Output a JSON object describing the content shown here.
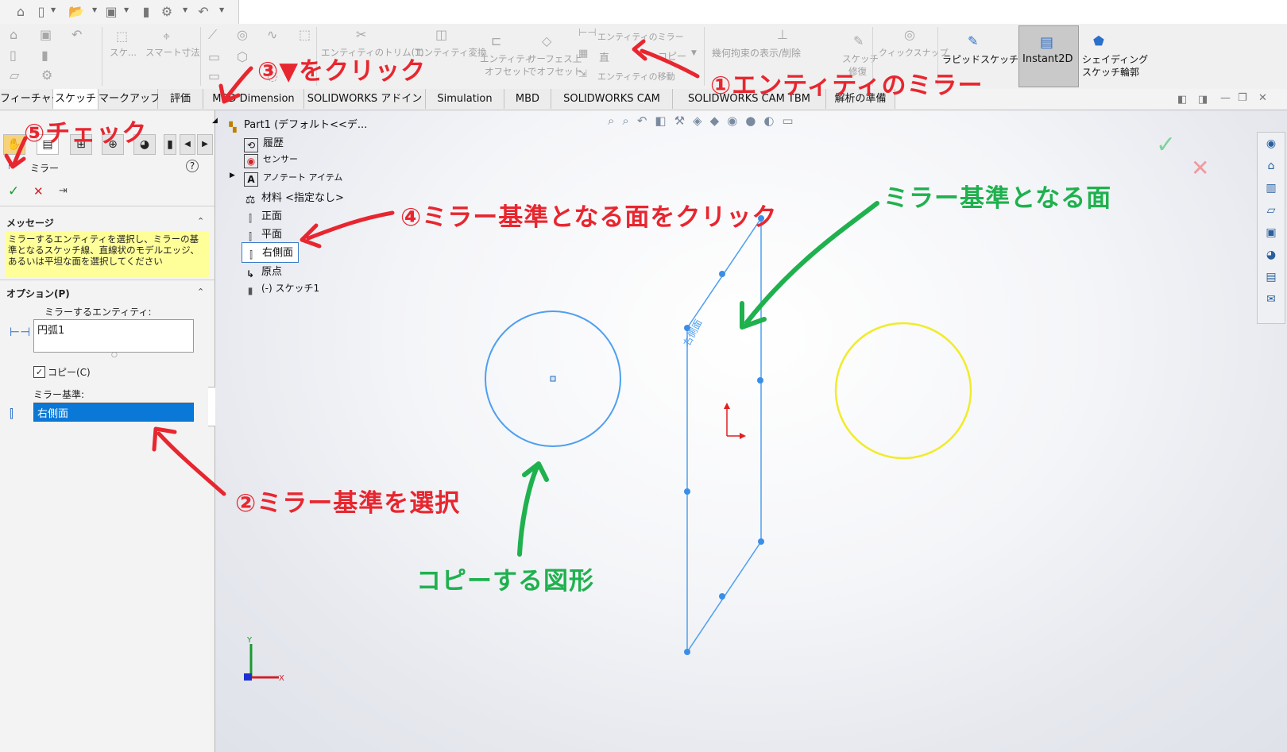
{
  "quickbar": {
    "icons": [
      "home-icon",
      "new-file-icon",
      "open-icon",
      "save-icon",
      "print-icon",
      "gear-icon",
      "undo-icon"
    ]
  },
  "ribbon": {
    "sketch": "スケ...",
    "smart_dim": "スマート寸法",
    "trim": "エンティティのトリム(T)",
    "convert": "エンティティ変換",
    "offset_1": "エンティティ",
    "offset_2": "オフセット",
    "surface_1": "サーフェス上",
    "surface_2": "でオフセット",
    "mirror": "エンティティのミラー",
    "linear_pattern": "直",
    "copy": "コピー",
    "move": "エンティティの移動",
    "relations": "幾何拘束の表示/削除",
    "repair_1": "スケッチ",
    "repair_2": "修復",
    "quick_snap": "クィックスナップ",
    "rapid_sketch": "ラピッドスケッチ",
    "instant2d": "Instant2D",
    "shaded_1": "シェイディング",
    "shaded_2": "スケッチ輪郭"
  },
  "tabs": [
    "フィーチャー",
    "スケッチ",
    "マークアップ",
    "評価",
    "MBD Dimension",
    "SOLIDWORKS アドイン",
    "Simulation",
    "MBD",
    "SOLIDWORKS CAM",
    "SOLIDWORKS CAM TBM",
    "解析の準備"
  ],
  "panel": {
    "title": "ミラー",
    "help": "?",
    "message_header": "メッセージ",
    "message": "ミラーするエンティティを選択し、ミラーの基準となるスケッチ線、直線状のモデルエッジ、あるいは平坦な面を選択してください",
    "options_header": "オプション(P)",
    "entities_label": "ミラーするエンティティ:",
    "entities_value": "円弧1",
    "copy_label": "コピー(C)",
    "mirror_about_label": "ミラー基準:",
    "mirror_about_value": "右側面"
  },
  "tree": {
    "root": "Part1 (デフォルト<<デ...",
    "items": [
      "履歴",
      "センサー",
      "アノテート アイテム",
      "材料 <指定なし>",
      "正面",
      "平面",
      "右側面",
      "原点",
      "(-) スケッチ1"
    ]
  },
  "viewport": {
    "plane_label": "右側面",
    "axis_x": "X",
    "axis_y": "Y"
  },
  "annotations": {
    "step1": "①エンティティのミラー",
    "step2": "②ミラー基準を選択",
    "step3": "③▼をクリック",
    "step4": "④ミラー基準となる面をクリック",
    "step5": "⑤チェック",
    "green_plane": "ミラー基準となる面",
    "green_copy": "コピーする図形"
  },
  "colors": {
    "annotation_red": "#e8262f",
    "annotation_green": "#1fb14e",
    "sketch_blue": "#4e9ff0",
    "preview_yellow": "#f0ec2a",
    "selection_blue": "#0a78d7"
  }
}
